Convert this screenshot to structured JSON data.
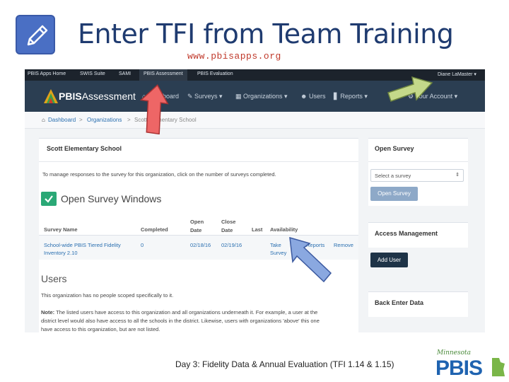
{
  "slide": {
    "title": "Enter TFI from Team Training",
    "url": "www.pbisapps.org",
    "footer": "Day 3: Fidelity Data & Annual Evaluation (TFI 1.14 & 1.15)",
    "logo_script": "Minnesota",
    "logo_text": "PBIS"
  },
  "topbar": {
    "items": [
      "PBIS Apps Home",
      "SWIS Suite",
      "SAMI",
      "PBIS Assessment",
      "PBIS Evaluation"
    ],
    "user": "Diane LaMaster ▾"
  },
  "navbar": {
    "brand_bold": "PBIS",
    "brand_rest": "Assessment",
    "items": [
      "Dashboard",
      "Surveys ▾",
      "Organizations ▾",
      "Users",
      "Reports ▾"
    ],
    "account": "Your Account ▾"
  },
  "breadcrumb": [
    "Dashboard",
    ">",
    "Organizations",
    ">",
    "Scott Elementary School"
  ],
  "main": {
    "school_name": "Scott Elementary School",
    "instructions": "To manage responses to the survey for this organization, click on the number of surveys completed.",
    "open_windows_title": "Open Survey Windows",
    "table": {
      "headers": [
        "Survey Name",
        "Completed",
        "Open Date",
        "Close Date",
        "Last",
        "Availability"
      ],
      "row": {
        "name_line1": "School-wide PBIS Tiered Fidelity",
        "name_line2": "Inventory 2.10",
        "completed": "0",
        "open_date": "02/18/16",
        "close_date": "02/19/16",
        "last": "",
        "take_line1": "Take",
        "take_line2": "Survey",
        "reports": "Reports",
        "remove": "Remove"
      }
    },
    "users_title": "Users",
    "users_text": "This organization has no people scoped specifically to it.",
    "note_label": "Note:",
    "note_lines": [
      "The listed users have access to this organization and all organizations underneath it. For example, a user at the",
      "district level would also have access to all the schools in the district. Likewise, users with organizations 'above' this one",
      "have access to this organization, but are not listed."
    ]
  },
  "sidebar": {
    "open_survey_title": "Open Survey",
    "select_placeholder": "Select a survey",
    "open_survey_button": "Open Survey",
    "access_title": "Access Management",
    "add_user_button": "Add User",
    "back_title": "Back Enter Data"
  },
  "colors": {
    "title": "#1f3b70",
    "url": "#c0392b",
    "nav": "#2b3e52",
    "topbar": "#1c232c",
    "link": "#2a6fb0",
    "check": "#2aa876"
  }
}
